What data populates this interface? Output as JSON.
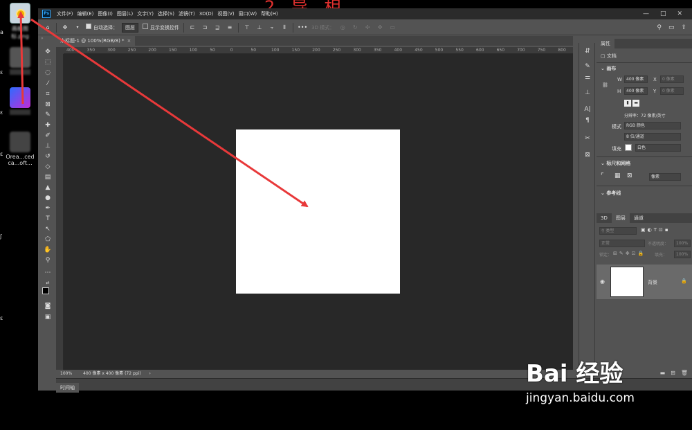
{
  "desktop": {
    "icons": [
      {
        "label": "画板图标.png",
        "name": "image-file"
      },
      {
        "label": "",
        "name": "app-shortcut"
      },
      {
        "label": "",
        "name": "app-shortcut-blue"
      },
      {
        "label": "Orea...ced ca...oft...",
        "name": "app-shortcut-dark"
      }
    ],
    "side_letters": [
      "a",
      "ɛ",
      "ɛ",
      "ɛ",
      "ʃ",
      "ɛ"
    ],
    "top_red_text": "2 导 相"
  },
  "ps": {
    "logo": "Ps",
    "menus": [
      "文件(F)",
      "编辑(E)",
      "图像(I)",
      "图层(L)",
      "文字(Y)",
      "选择(S)",
      "滤镜(T)",
      "3D(D)",
      "视图(V)",
      "窗口(W)",
      "帮助(H)"
    ],
    "window_controls": [
      "—",
      "□",
      "✕"
    ],
    "options": {
      "home_icon": "home-icon",
      "auto_select_label": "自动选择：",
      "auto_select_value": "图层",
      "transform_label": "显示变换控件",
      "mode_3d_label": "3D 模式："
    },
    "document_tab": {
      "title": "未标题-1 @ 100%(RGB/8) *",
      "close": "×"
    },
    "ruler_ticks": [
      "400",
      "350",
      "300",
      "250",
      "200",
      "150",
      "100",
      "50",
      "0",
      "50",
      "100",
      "150",
      "200",
      "250",
      "300",
      "350",
      "400",
      "450",
      "500",
      "550",
      "600",
      "650",
      "700",
      "750",
      "800"
    ],
    "status": {
      "zoom": "100%",
      "doc_size": "400 像素 x 400 像素 (72 ppi)",
      "arrow": "›"
    },
    "timeline_label": "时间轴"
  },
  "properties": {
    "tab": "属性",
    "doc_label": "文档",
    "canvas_header": "画布",
    "w_label": "W",
    "w_value": "400 像素",
    "h_label": "H",
    "h_value": "400 像素",
    "x_label": "X",
    "x_value": "0 像素",
    "y_label": "Y",
    "y_value": "0 像素",
    "resolution": "分辨率：72 像素/英寸",
    "mode_label": "模式",
    "mode_value": "RGB 颜色",
    "depth_value": "8 位/通道",
    "fill_label": "填充",
    "fill_value": "白色",
    "rulers_header": "标尺和网格",
    "rulers_unit": "像素",
    "guides_header": "参考线"
  },
  "layers": {
    "tabs": [
      "3D",
      "图层",
      "通道"
    ],
    "search_placeholder": "类型",
    "blend_mode": "正常",
    "opacity_label": "不透明度：",
    "opacity_value": "100%",
    "lock_label": "锁定：",
    "fill_label": "填充：",
    "fill_value": "100%",
    "layer_name": "背景"
  },
  "watermark": {
    "logo": "Bai 经验",
    "url": "jingyan.baidu.com"
  },
  "colors": {
    "arrow": "#e8393a",
    "ps_bg": "#535353",
    "canvas_bg": "#282828",
    "menubar": "#2b2b2b"
  }
}
